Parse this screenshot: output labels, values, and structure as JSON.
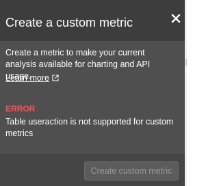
{
  "dialog": {
    "title": "Create a custom metric",
    "close_icon": "close-icon",
    "description": "Create a metric to make your current analysis available for charting and API usage.",
    "learn_more": {
      "label": "Learn more",
      "icon": "external-link-icon"
    },
    "error": {
      "title": "ERROR",
      "message": "Table useraction is not supported for custom metrics"
    },
    "create_button": {
      "label": "Create custom metric",
      "disabled": true
    }
  },
  "colors": {
    "dialog_background": "#4f4f4f",
    "header_background": "#3d3d3d",
    "footer_background": "#454545",
    "error": "#ff4d5a",
    "text": "#ffffff",
    "disabled_text": "#9a9a9a"
  }
}
